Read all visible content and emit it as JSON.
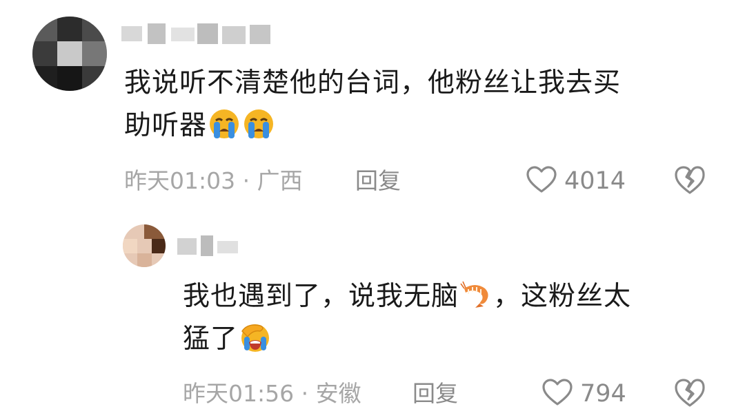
{
  "comments": [
    {
      "username": "",
      "text_line1": "我说听不清楚他的台词，他粉丝让我去买",
      "text_line2": "助听器",
      "emojis": [
        "loudly-crying-face",
        "loudly-crying-face"
      ],
      "time_location": "昨天01:03 · 广西",
      "reply_label": "回复",
      "like_count": "4014"
    },
    {
      "username": "",
      "text_part1": "我也遇到了，说我无脑",
      "emoji_mid": "shrimp",
      "text_part2": "，这粉丝太",
      "text_line2": "猛了",
      "emoji_end": "face-palm-crying",
      "time_location": "昨天01:56 · 安徽",
      "reply_label": "回复",
      "like_count": "794"
    }
  ],
  "colors": {
    "text": "#1a1a1a",
    "meta": "#a6a6a6",
    "action": "#8a8a8a",
    "emoji_face": "#f5b524",
    "emoji_tear": "#3a8fe0"
  }
}
